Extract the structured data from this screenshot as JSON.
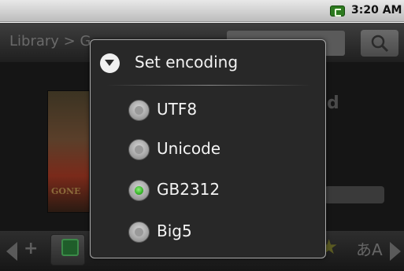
{
  "status_bar": {
    "time": "3:20 AM",
    "battery_icon": "battery-charging-icon"
  },
  "title_bar": {
    "breadcrumb": "Library > G",
    "search_icon": "search-icon"
  },
  "book": {
    "cover_text": "GONE"
  },
  "dialog": {
    "title": "Set encoding",
    "title_icon": "dropdown-circle-icon",
    "selected": "GB2312",
    "options": [
      {
        "label": "UTF8",
        "checked": false
      },
      {
        "label": "Unicode",
        "checked": false
      },
      {
        "label": "GB2312",
        "checked": true
      },
      {
        "label": "Big5",
        "checked": false
      }
    ]
  },
  "colors": {
    "radio_selected": "#38b42a",
    "dialog_bg": "#282828"
  }
}
